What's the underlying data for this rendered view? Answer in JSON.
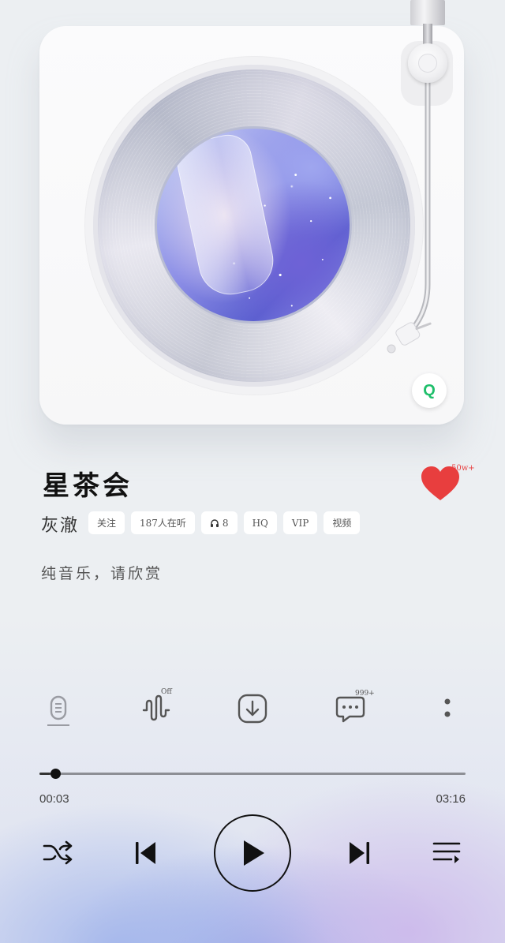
{
  "player": {
    "brand_badge": "Q"
  },
  "song": {
    "title": "星茶会",
    "artist": "灰澈",
    "description": "纯音乐，请欣赏",
    "like_count": "50w+"
  },
  "tags": {
    "follow": "关注",
    "listeners": "187人在听",
    "headphone_count": "8",
    "quality": "HQ",
    "vip": "VIP",
    "video": "视频"
  },
  "actions": {
    "effects_badge": "Off",
    "comments_badge": "999+"
  },
  "progress": {
    "current": "00:03",
    "total": "03:16",
    "fraction": 0.015
  },
  "colors": {
    "heart": "#e83e3e",
    "brand": "#1fbf6b"
  },
  "icons": [
    "lyrics-icon",
    "sound-effect-icon",
    "download-icon",
    "comment-icon",
    "more-icon",
    "shuffle-icon",
    "previous-icon",
    "play-icon",
    "next-icon",
    "playlist-icon",
    "heart-icon",
    "headphone-icon"
  ]
}
